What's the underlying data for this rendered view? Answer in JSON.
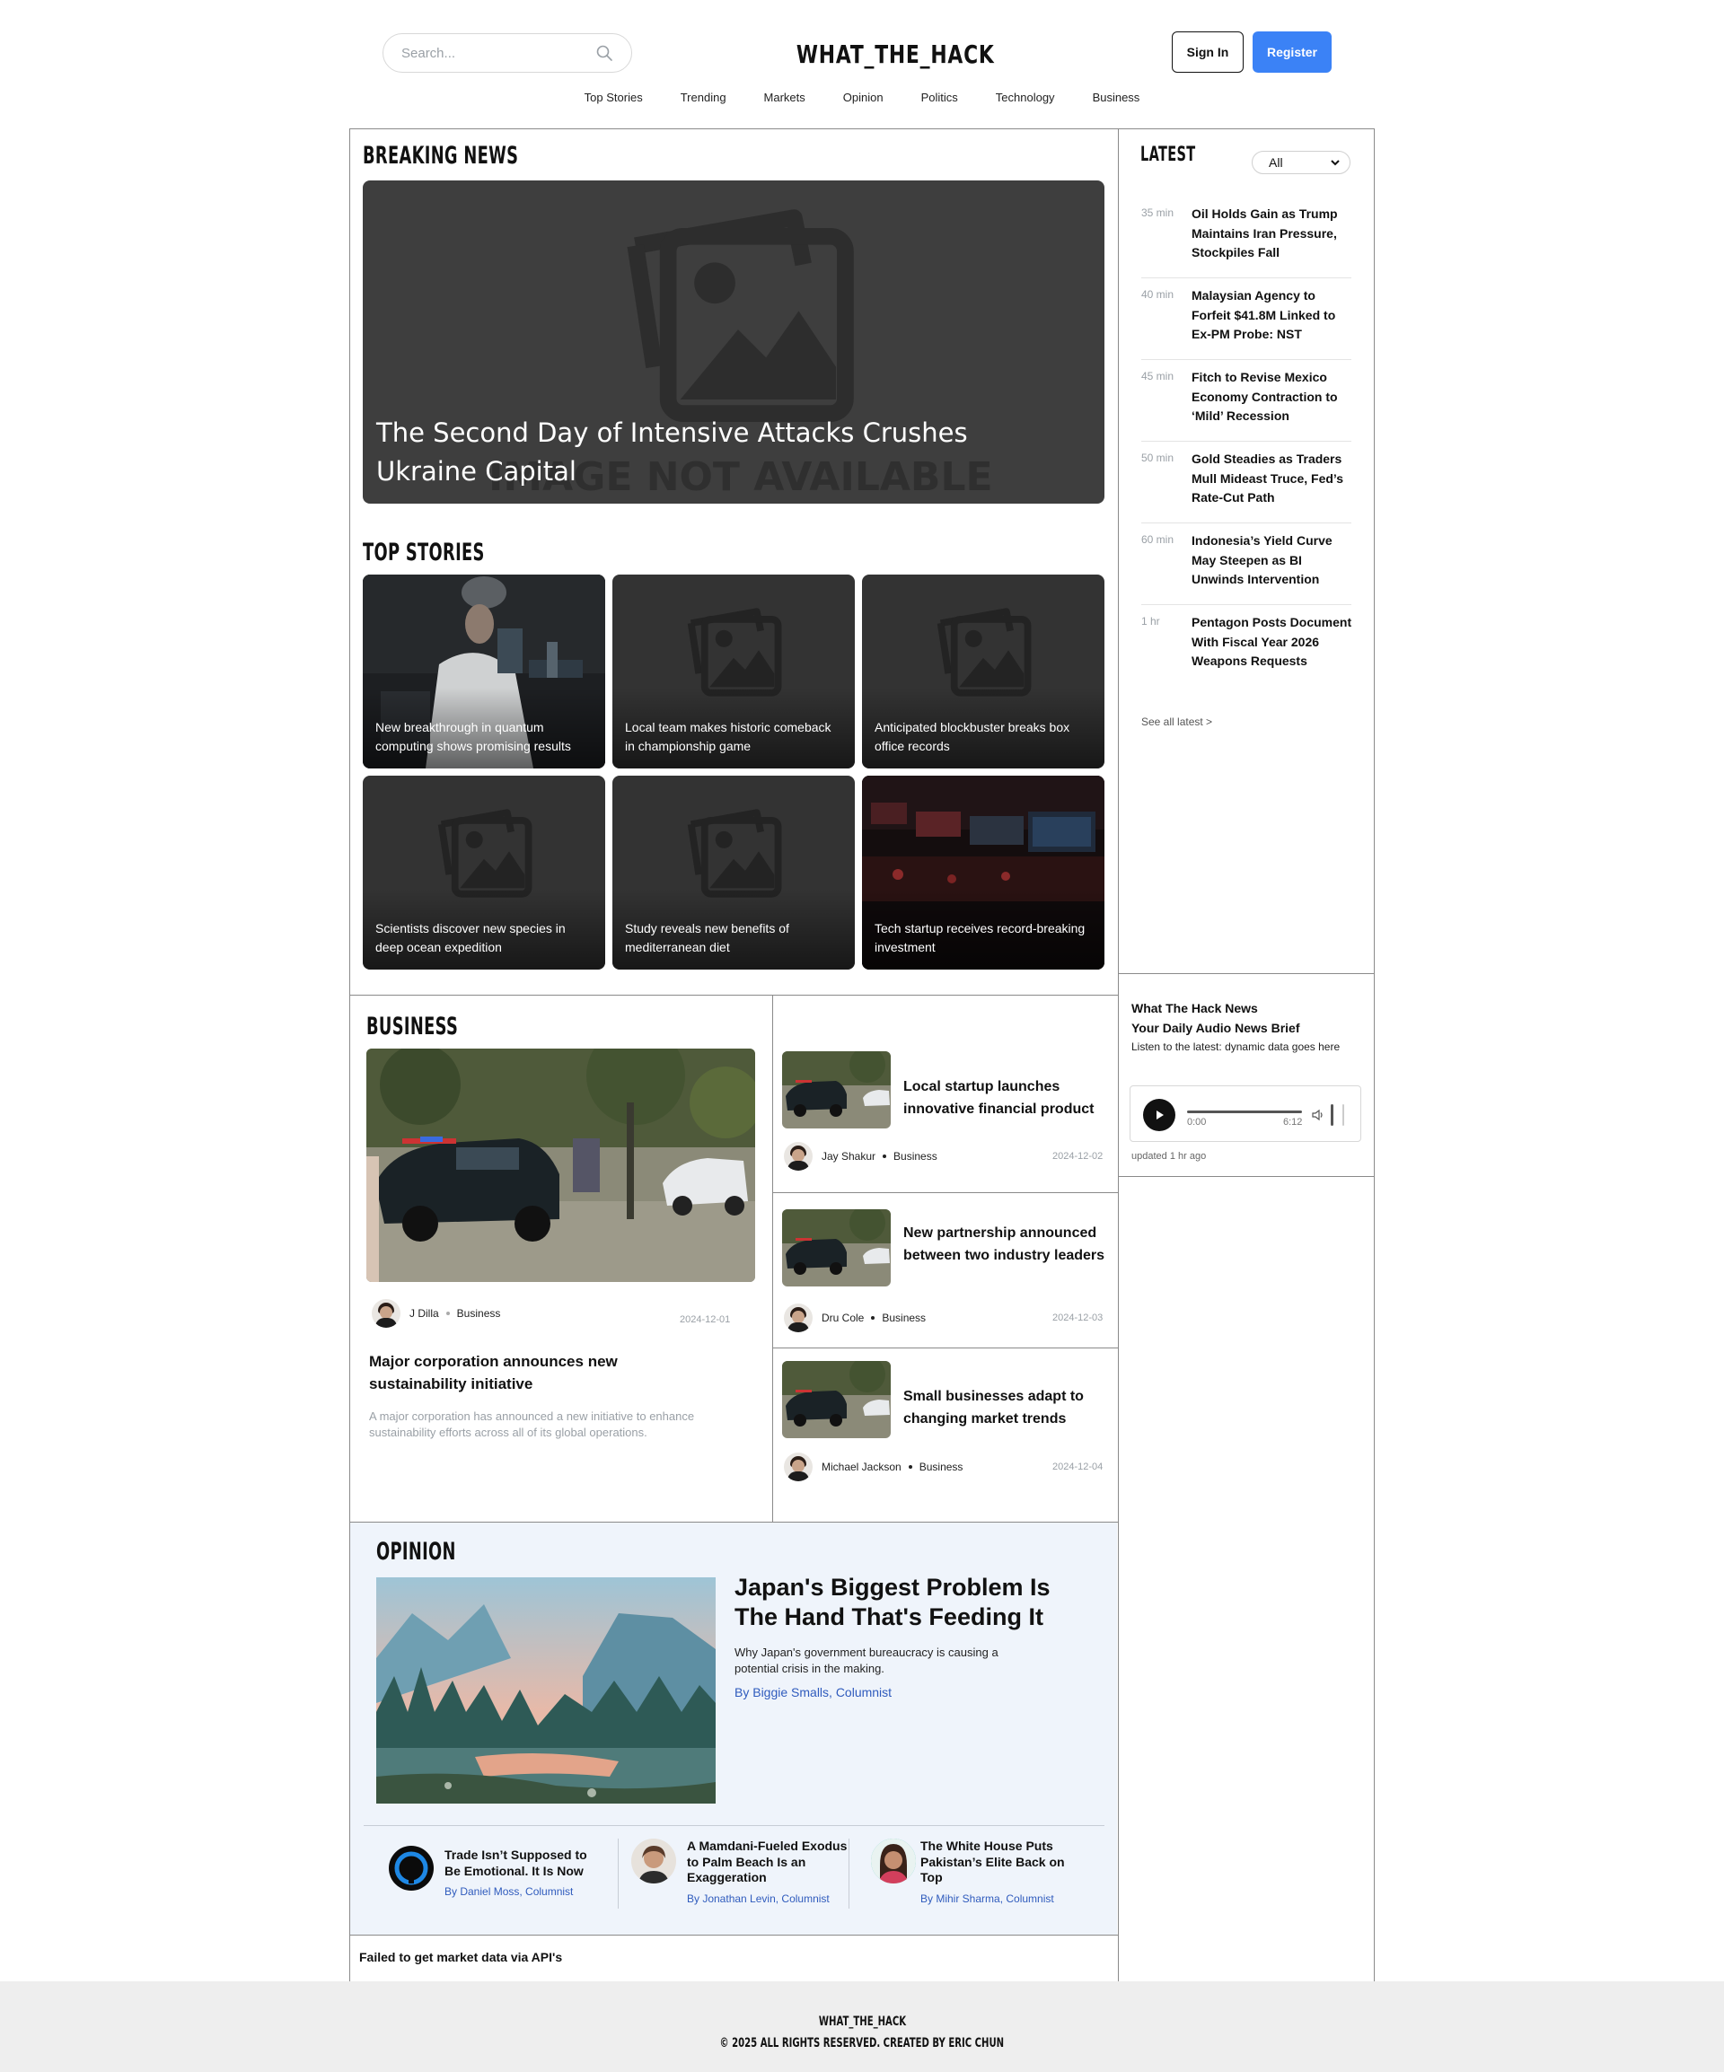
{
  "header": {
    "search_placeholder": "Search...",
    "logo": "WHAT_THE_HACK",
    "sign_in": "Sign In",
    "register": "Register",
    "accent": "#3b82f6"
  },
  "nav": [
    "Top Stories",
    "Trending",
    "Markets",
    "Opinion",
    "Politics",
    "Technology",
    "Business"
  ],
  "breaking": {
    "section_title": "BREAKING NEWS",
    "headline": "The Second Day of Intensive Attacks Crushes Ukraine Capital",
    "placeholder_text": "IMAGE NOT AVAILABLE"
  },
  "top_stories": {
    "section_title": "TOP STORIES",
    "items": [
      {
        "caption": "New breakthrough in quantum computing shows promising results",
        "image": "lab-photo"
      },
      {
        "caption": "Local team makes historic comeback in championship game",
        "image": "placeholder"
      },
      {
        "caption": "Anticipated blockbuster breaks box office records",
        "image": "placeholder"
      },
      {
        "caption": "Scientists discover new species in deep ocean expedition",
        "image": "placeholder"
      },
      {
        "caption": "Study reveals new benefits of mediterranean diet",
        "image": "placeholder"
      },
      {
        "caption": "Tech startup receives record-breaking investment",
        "image": "trading-desk-photo"
      }
    ]
  },
  "latest": {
    "section_title": "LATEST",
    "filter": "All",
    "items": [
      {
        "time": "35 min",
        "headline": "Oil Holds Gain as Trump Maintains Iran Pressure, Stockpiles Fall"
      },
      {
        "time": "40 min",
        "headline": "Malaysian Agency to Forfeit $41.8M Linked to Ex-PM Probe: NST"
      },
      {
        "time": "45 min",
        "headline": "Fitch to Revise Mexico Economy Contraction to ‘Mild’ Recession"
      },
      {
        "time": "50 min",
        "headline": "Gold Steadies as Traders Mull Mideast Truce, Fed’s Rate-Cut Path"
      },
      {
        "time": "60 min",
        "headline": "Indonesia’s Yield Curve May Steepen as BI Unwinds Intervention"
      },
      {
        "time": "1 hr",
        "headline": "Pentagon Posts Document With Fiscal Year 2026 Weapons Requests"
      }
    ],
    "see_all": "See all latest >"
  },
  "audio": {
    "title": "What The Hack News",
    "subtitle": "Your Daily Audio News Brief",
    "description": "Listen to the latest: dynamic data goes here",
    "current_time": "0:00",
    "duration": "6:12",
    "updated": "updated 1 hr ago"
  },
  "business": {
    "section_title": "BUSINESS",
    "main": {
      "author": "J Dilla",
      "category": "Business",
      "date": "2024-12-01",
      "headline": "Major corporation announces new sustainability initiative",
      "description": "A major corporation has announced a new initiative to enhance sustainability efforts across all of its global operations."
    },
    "side": [
      {
        "headline": "Local startup launches innovative financial product",
        "author": "Jay Shakur",
        "category": "Business",
        "date": "2024-12-02"
      },
      {
        "headline": "New partnership announced between two industry leaders",
        "author": "Dru Cole",
        "category": "Business",
        "date": "2024-12-03"
      },
      {
        "headline": "Small businesses adapt to changing market trends",
        "author": "Michael Jackson",
        "category": "Business",
        "date": "2024-12-04"
      }
    ]
  },
  "opinion": {
    "section_title": "OPINION",
    "feature": {
      "headline": "Japan's Biggest Problem Is The Hand That's Feeding It",
      "description": "Why Japan's government bureaucracy is causing a potential crisis in the making.",
      "byline": "By Biggie Smalls, Columnist"
    },
    "items": [
      {
        "headline": "Trade Isn’t Supposed to Be Emotional. It Is Now",
        "byline": "By Daniel Moss, Columnist"
      },
      {
        "headline": "A Mamdani-Fueled Exodus to Palm Beach Is an Exaggeration",
        "byline": "By Jonathan Levin, Columnist"
      },
      {
        "headline": "The White House Puts Pakistan’s Elite Back on Top",
        "byline": "By Mihir Sharma, Columnist"
      }
    ]
  },
  "market_error": "Failed to get market data via API's",
  "footer": {
    "brand": "WHAT_THE_HACK",
    "copyright": "© 2025 ALL RIGHTS RESERVED. CREATED BY ERIC CHUN"
  }
}
